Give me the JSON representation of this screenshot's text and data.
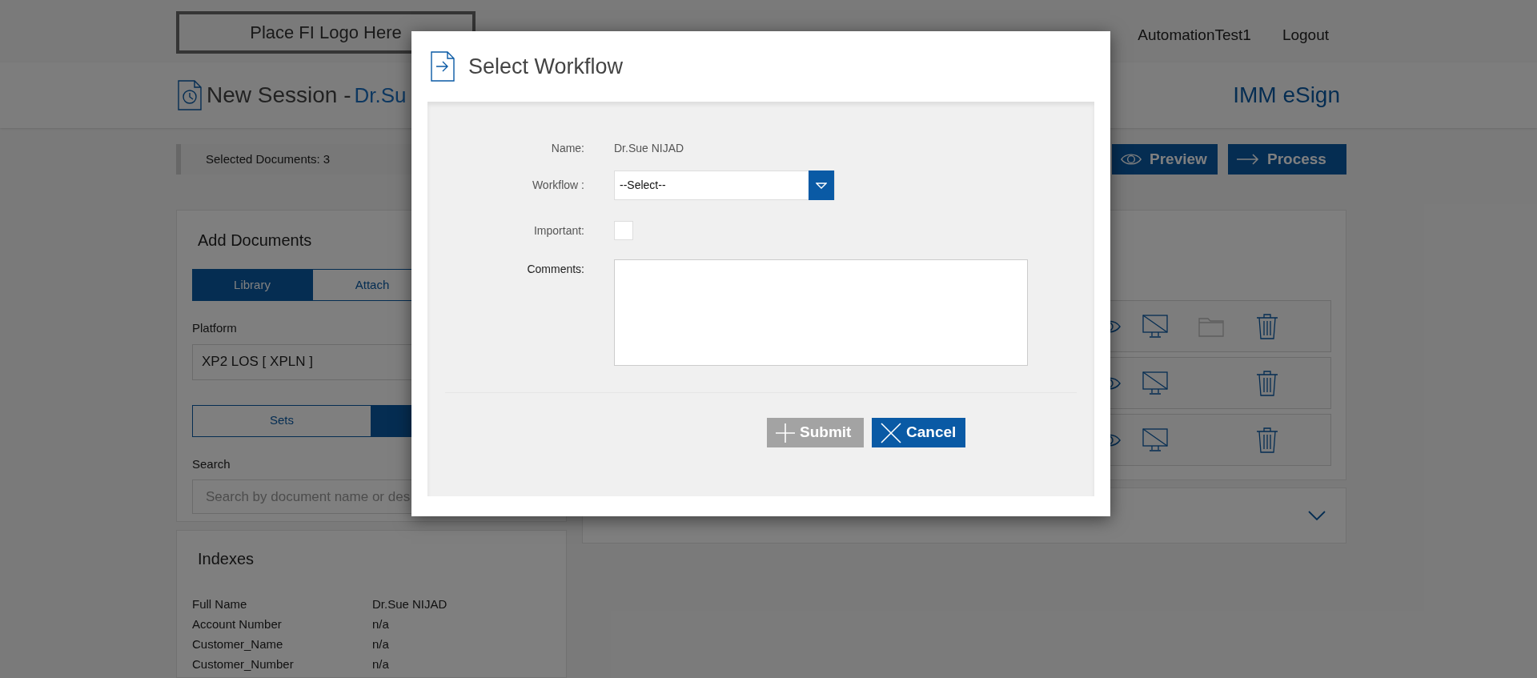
{
  "header": {
    "logo": "Place FI Logo Here",
    "nav": [
      "AutomationTest1",
      "Logout"
    ]
  },
  "session": {
    "title": "New Session -",
    "customer": "Dr.Su",
    "product": "IMM eSign"
  },
  "toolbar": {
    "selected_documents": "Selected Documents: 3",
    "buttons": [
      {
        "label": "Preview",
        "kind": "preview"
      },
      {
        "label": "Process",
        "kind": "process"
      }
    ]
  },
  "add_documents": {
    "title": "Add Documents",
    "source_tabs": [
      {
        "label": "Library",
        "selected": true
      },
      {
        "label": "Attach",
        "selected": false
      }
    ],
    "platform": {
      "label": "Platform",
      "value": "XP2 LOS [ XPLN ]"
    },
    "mode_tabs": [
      {
        "label": "Sets",
        "selected": false
      },
      {
        "selected": true
      }
    ],
    "search": {
      "label": "Search",
      "placeholder": "Search by document name or des"
    }
  },
  "documents": [
    {
      "has_folder": true
    },
    {
      "has_folder": false
    },
    {
      "has_folder": false
    }
  ],
  "documents_library": {
    "expanded": false
  },
  "indexes": {
    "title": "Indexes",
    "rows": [
      {
        "name": "Full Name",
        "value": "Dr.Sue NIJAD"
      },
      {
        "name": "Account Number",
        "value": "n/a"
      },
      {
        "name": "Customer_Name",
        "value": "n/a"
      },
      {
        "name": "Customer_Number",
        "value": "n/a"
      }
    ]
  },
  "dialog": {
    "title": "Select Workflow",
    "name": {
      "label": "Name:",
      "value": "Dr.Sue NIJAD"
    },
    "workflow": {
      "label": "Workflow :",
      "value": "--Select--"
    },
    "important": {
      "label": "Important:",
      "checked": false
    },
    "comments": {
      "label": "Comments:"
    },
    "buttons": [
      {
        "label": "Submit",
        "kind": "submit",
        "disabled": true
      },
      {
        "label": "Cancel",
        "kind": "cancel",
        "disabled": false
      }
    ]
  }
}
